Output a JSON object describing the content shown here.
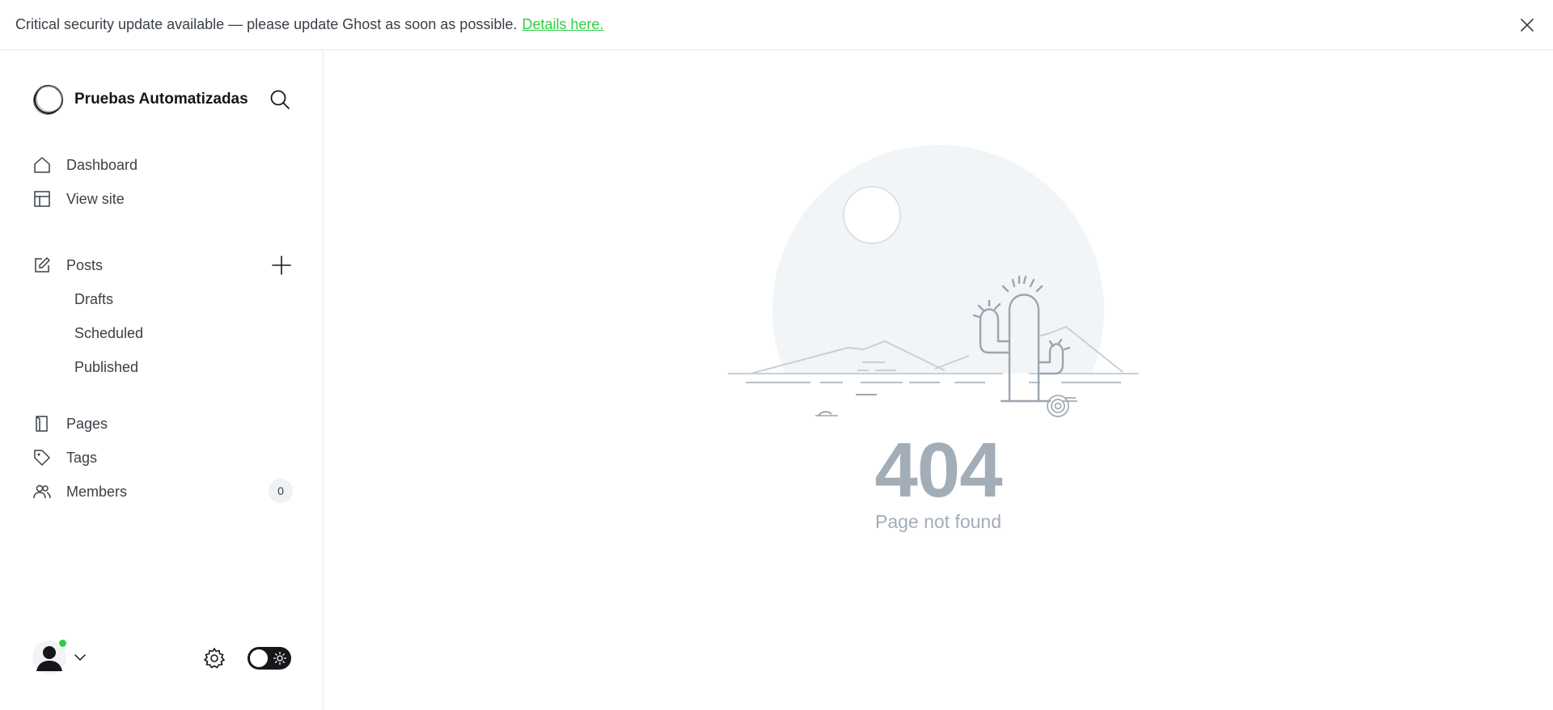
{
  "alert": {
    "message": "Critical security update available — please update Ghost as soon as possible.",
    "link_text": "Details here."
  },
  "sidebar": {
    "site_name": "Pruebas Automatizadas",
    "nav": {
      "dashboard": "Dashboard",
      "view_site": "View site",
      "posts": "Posts",
      "drafts": "Drafts",
      "scheduled": "Scheduled",
      "published": "Published",
      "pages": "Pages",
      "tags": "Tags",
      "members": "Members",
      "members_count": "0"
    }
  },
  "main": {
    "error_code": "404",
    "error_message": "Page not found"
  },
  "colors": {
    "accent_green": "#30cf43",
    "error_gray": "#a3adb8"
  }
}
